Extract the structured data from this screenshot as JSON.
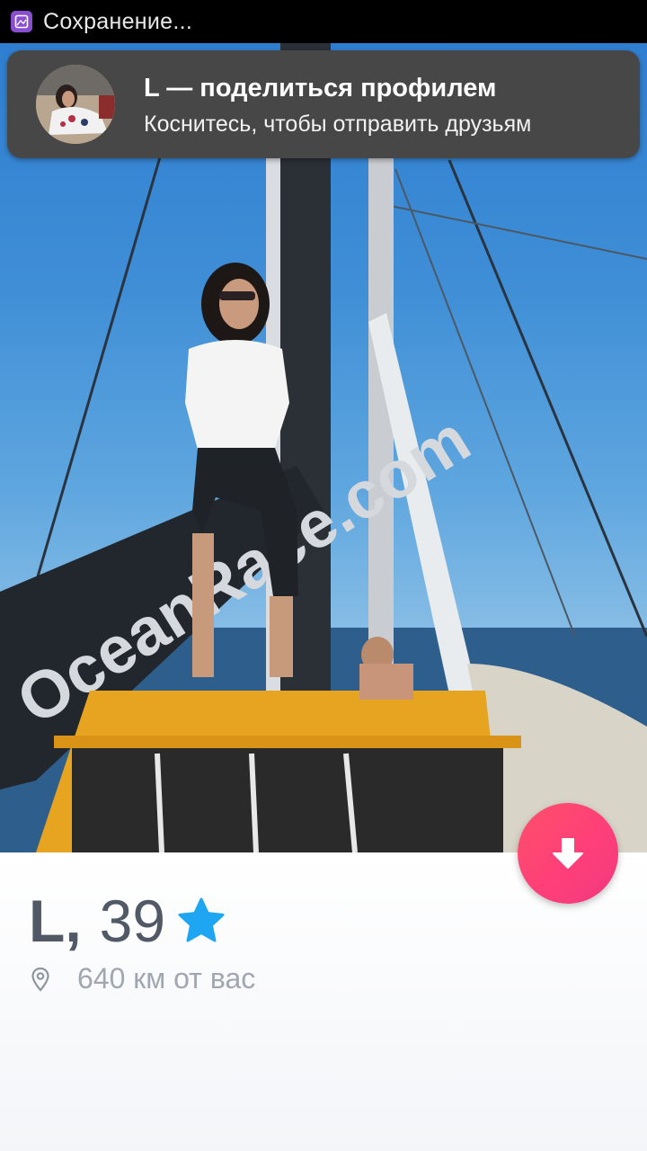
{
  "status_bar": {
    "text": "Сохранение...",
    "icon": "gallery-icon"
  },
  "notification": {
    "title": "L — поделиться профилем",
    "subtitle": "Коснитесь, чтобы отправить друзьям",
    "avatar_icon": "profile-avatar"
  },
  "photo": {
    "hull_text": "OceanRace.com",
    "description_icon": "profile-photo"
  },
  "profile": {
    "name": "L",
    "comma": ",",
    "age": "39",
    "verified_icon": "star-badge-icon",
    "distance": "640 км от вас",
    "location_icon": "location-pin-icon"
  },
  "actions": {
    "collapse_icon": "arrow-down-icon"
  },
  "colors": {
    "accent": "#fd5068",
    "star": "#1ea6f2",
    "text_dark": "#505965",
    "text_muted": "#a1a7b0"
  }
}
